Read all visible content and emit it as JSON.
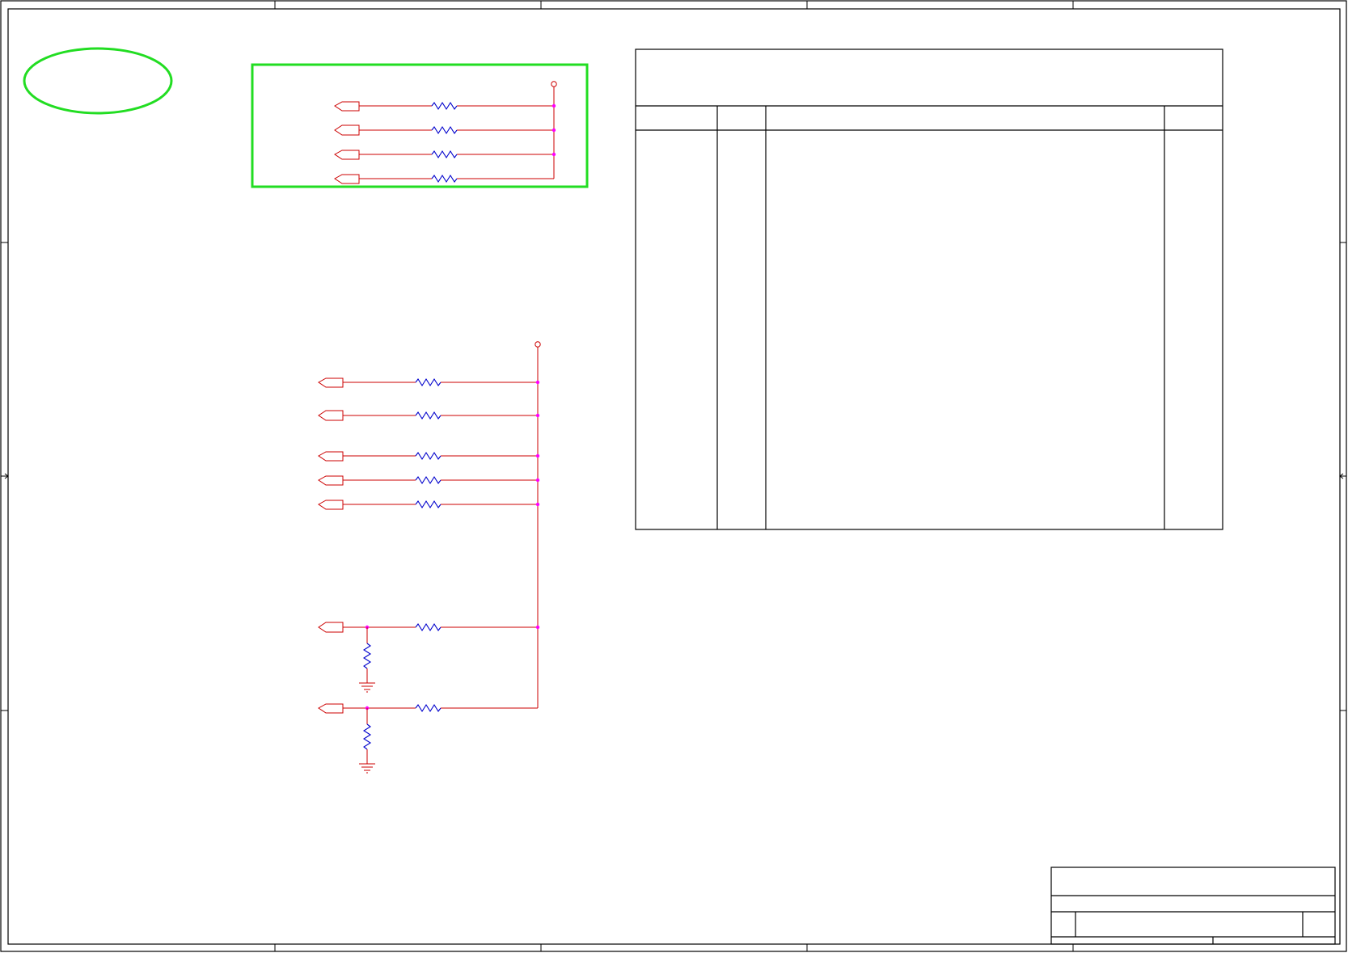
{
  "sheet": {
    "title": "",
    "revision_table": {
      "header": "",
      "columns": [
        "",
        "",
        "",
        ""
      ],
      "rows": []
    },
    "title_block": {
      "company": "",
      "doc_title": "",
      "size": "",
      "doc_number": "",
      "rev": "",
      "date": "",
      "sheet": ""
    }
  },
  "colors": {
    "wire": "#cc0000",
    "resistor": "#0000cc",
    "junction": "#ff00ff",
    "highlight": "#22dd22"
  },
  "circuit_top": {
    "nets": [
      "",
      "",
      "",
      ""
    ],
    "rail": ""
  },
  "circuit_bottom": {
    "nets": [
      "",
      "",
      "",
      "",
      "",
      "",
      ""
    ],
    "rail": ""
  }
}
